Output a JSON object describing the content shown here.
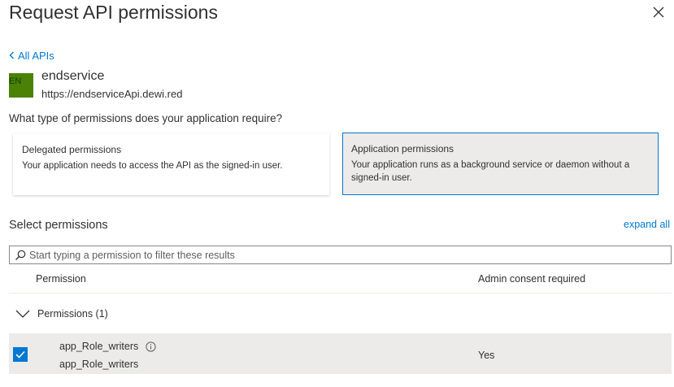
{
  "panel": {
    "title": "Request API permissions",
    "back_label": "All APIs"
  },
  "api": {
    "avatar_initials": "EN",
    "avatar_color": "#498205",
    "name": "endservice",
    "url": "https://endserviceApi.dewi.red"
  },
  "permission_type": {
    "question": "What type of permissions does your application require?",
    "options": [
      {
        "title": "Delegated permissions",
        "description": "Your application needs to access the API as the signed-in user.",
        "selected": false
      },
      {
        "title": "Application permissions",
        "description": "Your application runs as a background service or daemon without a signed-in user.",
        "selected": true
      }
    ]
  },
  "select_permissions": {
    "label": "Select permissions",
    "expand_all": "expand all",
    "search_placeholder": "Start typing a permission to filter these results",
    "columns": {
      "permission": "Permission",
      "admin_consent": "Admin consent required"
    },
    "groups": [
      {
        "label": "Permissions (1)",
        "expanded": true,
        "items": [
          {
            "name": "app_Role_writers",
            "description": "app_Role_writers",
            "admin_consent": "Yes",
            "checked": true
          }
        ]
      }
    ]
  },
  "colors": {
    "accent": "#0078d4",
    "selected_bg": "#edebe9",
    "text": "#323130"
  },
  "icons": {
    "close": "close-icon",
    "back": "chevron-left-icon",
    "search": "search-icon",
    "group_toggle": "chevron-down-icon",
    "checkbox": "checkmark-icon",
    "info": "info-icon"
  }
}
